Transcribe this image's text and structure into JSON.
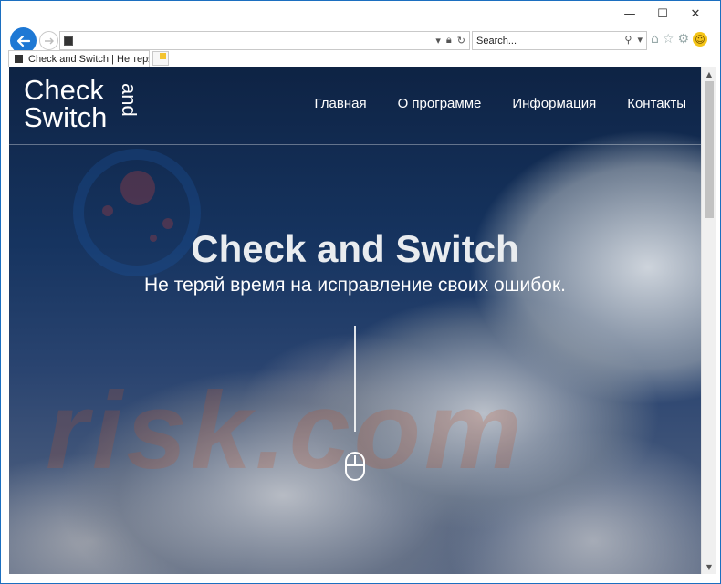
{
  "browser": {
    "window_controls": {
      "minimize": "—",
      "maximize": "☐",
      "close": "✕"
    },
    "search": {
      "placeholder": "Search..."
    },
    "tab": {
      "title": "Check and Switch | Не теря..."
    },
    "accent": "#1e78d4"
  },
  "site": {
    "logo": {
      "line1": "Check",
      "line2": "Switch",
      "and": "and"
    },
    "menu": [
      "Главная",
      "О программе",
      "Информация",
      "Контакты"
    ],
    "hero": {
      "title": "Check and Switch",
      "subtitle": "Не теряй время на исправление своих ошибок."
    },
    "watermark": "risk.com"
  }
}
